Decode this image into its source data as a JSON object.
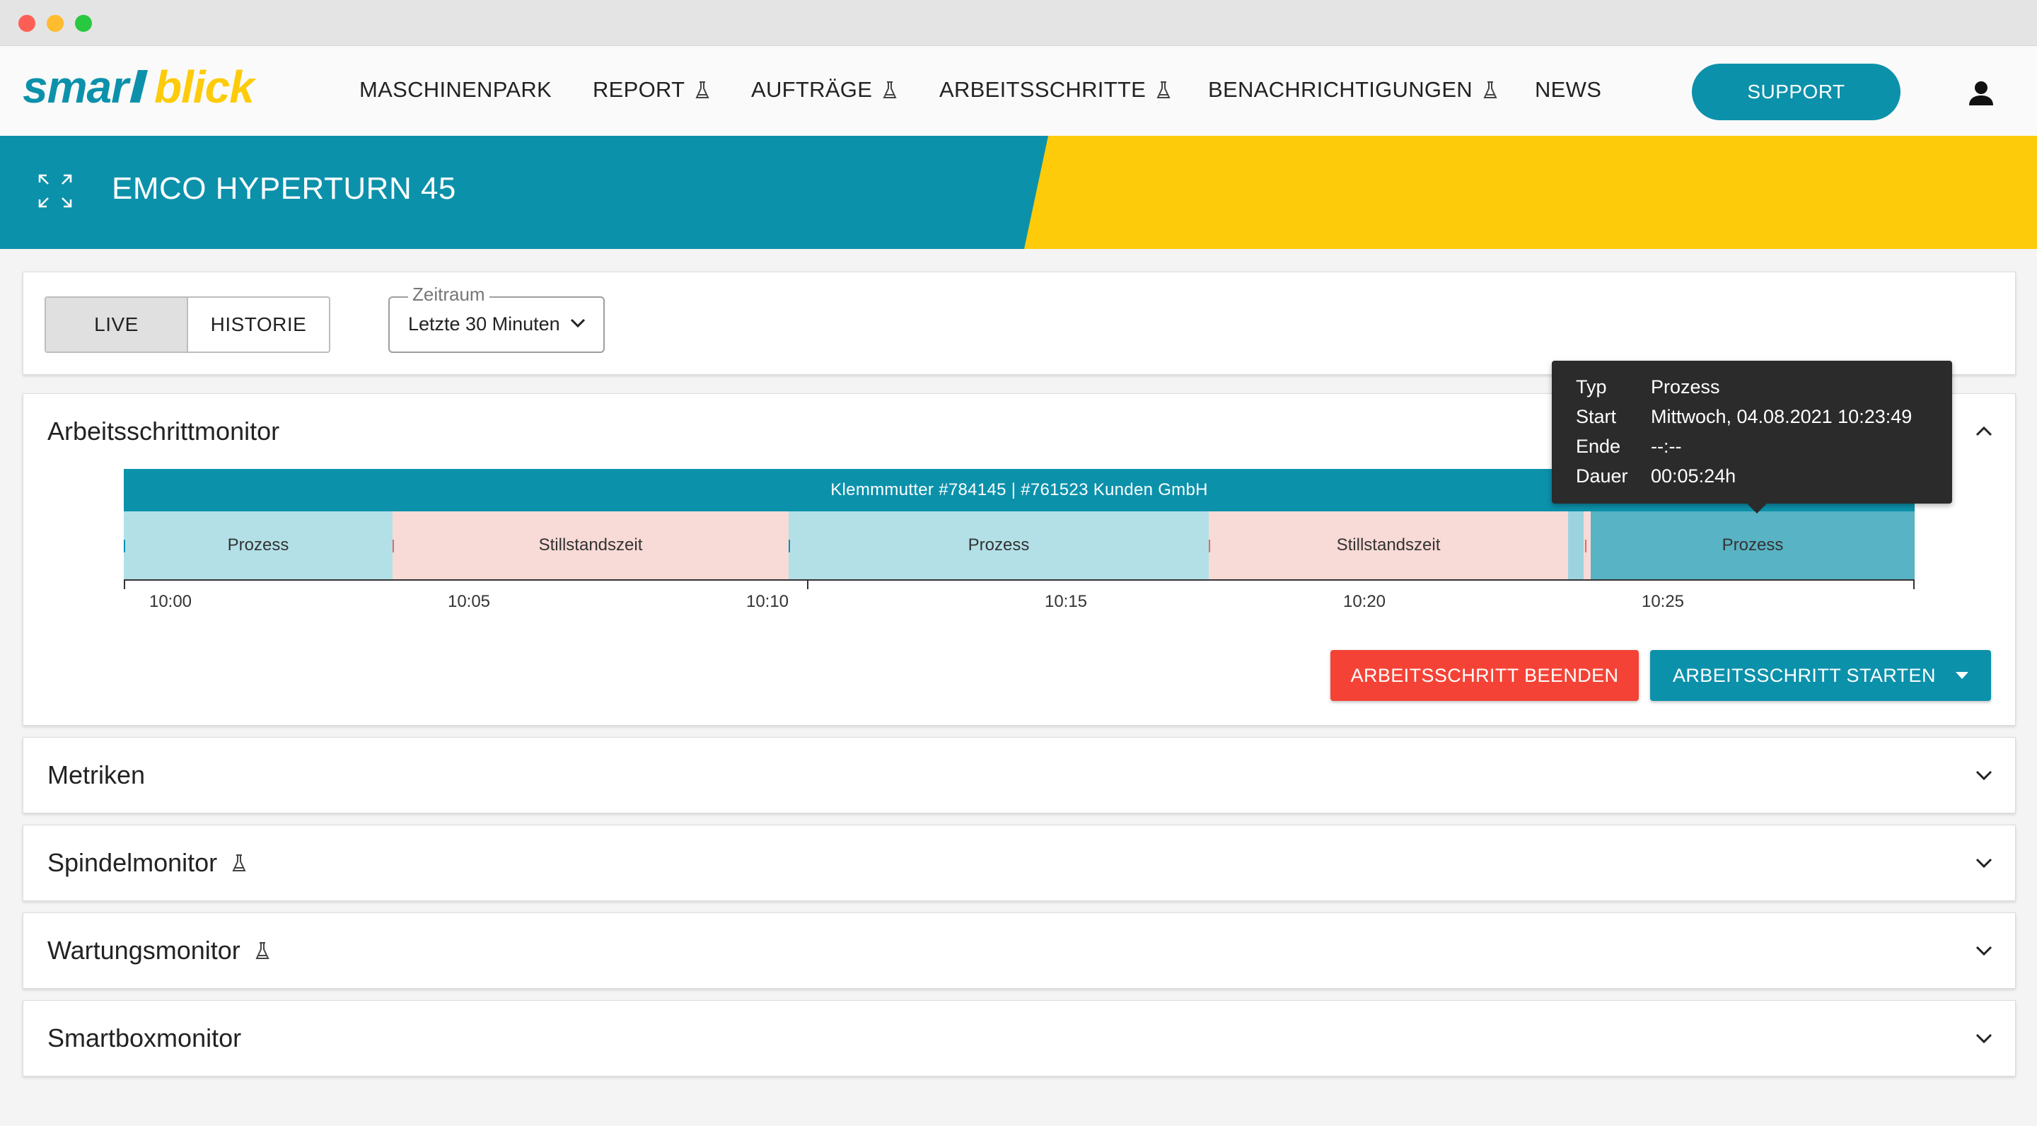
{
  "app": {
    "logo_text": "smartblick"
  },
  "nav": {
    "items": [
      {
        "label": "MASCHINENPARK",
        "beta": false
      },
      {
        "label": "REPORT",
        "beta": true
      },
      {
        "label": "AUFTRÄGE",
        "beta": true
      },
      {
        "label": "ARBEITSSCHRITTE",
        "beta": true
      },
      {
        "label": "BENACHRICHTIGUNGEN",
        "beta": true
      },
      {
        "label": "NEWS",
        "beta": false
      }
    ],
    "support_label": "SUPPORT",
    "user_icon": "user-icon"
  },
  "banner": {
    "machine_name": "EMCO HYPERTURN 45",
    "icon": "expand-icon"
  },
  "filters": {
    "modes": [
      "LIVE",
      "HISTORIE"
    ],
    "active_mode": "LIVE",
    "zeitraum_label": "Zeitraum",
    "zeitraum_value": "Letzte 30 Minuten"
  },
  "arbeitsschrittmonitor": {
    "title": "Arbeitsschrittmonitor",
    "job_label": "Klemmmutter #784145 | #761523 Kunden GmbH",
    "segments": [
      {
        "type": "prozess",
        "label": "Prozess"
      },
      {
        "type": "still",
        "label": "Stillstandszeit"
      },
      {
        "type": "prozess",
        "label": "Prozess"
      },
      {
        "type": "still",
        "label": "Stillstandszeit"
      },
      {
        "type": "sliver",
        "label": ""
      },
      {
        "type": "still",
        "label": ""
      },
      {
        "type": "prozess-active",
        "label": "Prozess"
      }
    ],
    "ticks": [
      "10:00",
      "10:05",
      "10:10",
      "10:15",
      "10:20",
      "10:25"
    ],
    "btn_end": "ARBEITSSCHRITT BEENDEN",
    "btn_start": "ARBEITSSCHRITT STARTEN"
  },
  "tooltip": {
    "rows": [
      {
        "key": "Typ",
        "value": "Prozess"
      },
      {
        "key": "Start",
        "value": "Mittwoch, 04.08.2021 10:23:49"
      },
      {
        "key": "Ende",
        "value": "--:--"
      },
      {
        "key": "Dauer",
        "value": "00:05:24h"
      }
    ]
  },
  "sections": [
    {
      "title": "Metriken",
      "beta": false
    },
    {
      "title": "Spindelmonitor",
      "beta": true
    },
    {
      "title": "Wartungsmonitor",
      "beta": true
    },
    {
      "title": "Smartboxmonitor",
      "beta": false
    }
  ],
  "colors": {
    "brand_blue": "#0c91ab",
    "brand_yellow": "#fdcb0a",
    "danger": "#f44336"
  }
}
